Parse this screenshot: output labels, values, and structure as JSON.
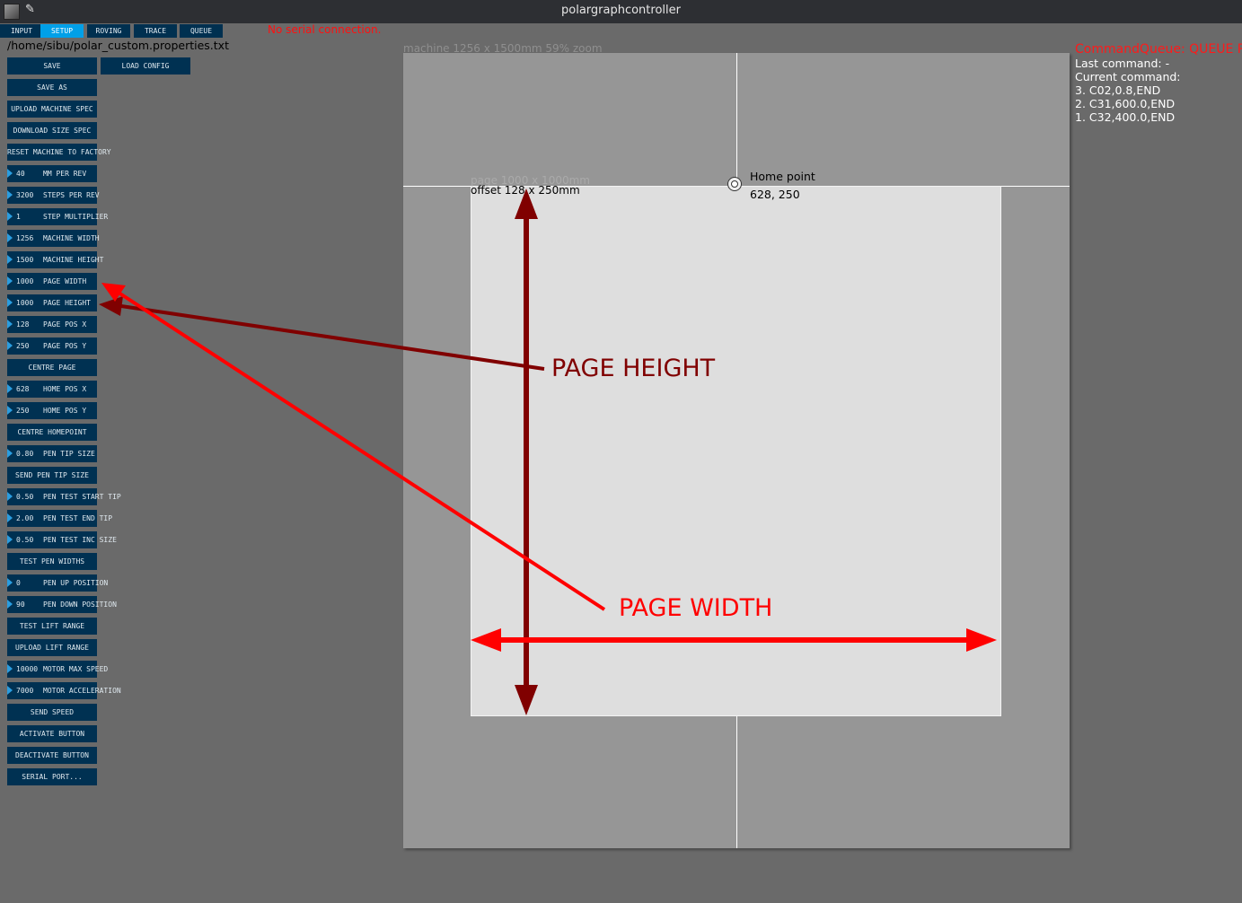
{
  "window": {
    "title": "polargraphcontroller",
    "icon": "app-icon",
    "pin": "pin-icon"
  },
  "tabs": [
    {
      "label": "INPUT",
      "active": false
    },
    {
      "label": "SETUP",
      "active": true
    },
    {
      "label": "ROVING",
      "active": false
    },
    {
      "label": "TRACE",
      "active": false
    },
    {
      "label": "QUEUE",
      "active": false
    }
  ],
  "status": {
    "serial": "No serial connection."
  },
  "file_path": "/home/sibu/polar_custom.properties.txt",
  "controls": {
    "save": "SAVE",
    "load_config": "LOAD CONFIG",
    "save_as": "SAVE AS",
    "upload_machine_spec": "UPLOAD MACHINE SPEC",
    "download_size_spec": "DOWNLOAD SIZE SPEC",
    "reset_machine": "RESET MACHINE TO FACTORY",
    "mm_per_rev": {
      "value": "40",
      "label": "MM PER REV"
    },
    "steps_per_rev": {
      "value": "3200",
      "label": "STEPS PER REV"
    },
    "step_multiplier": {
      "value": "1",
      "label": "STEP MULTIPLIER"
    },
    "machine_width": {
      "value": "1256",
      "label": "MACHINE WIDTH"
    },
    "machine_height": {
      "value": "1500",
      "label": "MACHINE HEIGHT"
    },
    "page_width": {
      "value": "1000",
      "label": "PAGE WIDTH"
    },
    "page_height": {
      "value": "1000",
      "label": "PAGE HEIGHT"
    },
    "page_pos_x": {
      "value": "128",
      "label": "PAGE POS X"
    },
    "page_pos_y": {
      "value": "250",
      "label": "PAGE POS Y"
    },
    "centre_page": "CENTRE PAGE",
    "home_pos_x": {
      "value": "628",
      "label": "HOME POS X"
    },
    "home_pos_y": {
      "value": "250",
      "label": "HOME POS Y"
    },
    "centre_homepoint": "CENTRE HOMEPOINT",
    "pen_tip_size": {
      "value": "0.80",
      "label": "PEN TIP SIZE"
    },
    "send_pen_tip_size": "SEND PEN TIP SIZE",
    "pen_test_start_tip": {
      "value": "0.50",
      "label": "PEN TEST START TIP"
    },
    "pen_test_end_tip": {
      "value": "2.00",
      "label": "PEN TEST END TIP"
    },
    "pen_test_inc_size": {
      "value": "0.50",
      "label": "PEN TEST INC SIZE"
    },
    "test_pen_widths": "TEST PEN WIDTHS",
    "pen_up_position": {
      "value": "0",
      "label": "PEN UP POSITION"
    },
    "pen_down_position": {
      "value": "90",
      "label": "PEN DOWN POSITION"
    },
    "test_lift_range": "TEST LIFT RANGE",
    "upload_lift_range": "UPLOAD LIFT RANGE",
    "motor_max_speed": {
      "value": "10000",
      "label": "MOTOR MAX SPEED"
    },
    "motor_acceleration": {
      "value": "7000",
      "label": "MOTOR ACCELERATION"
    },
    "send_speed": "SEND SPEED",
    "activate_button": "ACTIVATE BUTTON",
    "deactivate_button": "DEACTIVATE BUTTON",
    "serial_port": "SERIAL PORT..."
  },
  "canvas": {
    "machine_label": "machine 1256 x 1500mm 59% zoom",
    "page_label": "page 1000 x 1000mm",
    "offset_label": "offset 128 x 250mm",
    "home_point_label": "Home point",
    "home_point_coords": "628, 250"
  },
  "command_queue": {
    "header": "CommandQueue: QUEUE R",
    "last_command": "Last command: -",
    "current_command": "Current command:",
    "items": [
      "3. C02,0.8,END",
      "2. C31,600.0,END",
      "1. C32,400.0,END"
    ]
  },
  "annotations": {
    "page_height": "PAGE HEIGHT",
    "page_width": "PAGE WIDTH",
    "colors": {
      "page_height": "#800000",
      "page_width": "#ff0000"
    }
  }
}
